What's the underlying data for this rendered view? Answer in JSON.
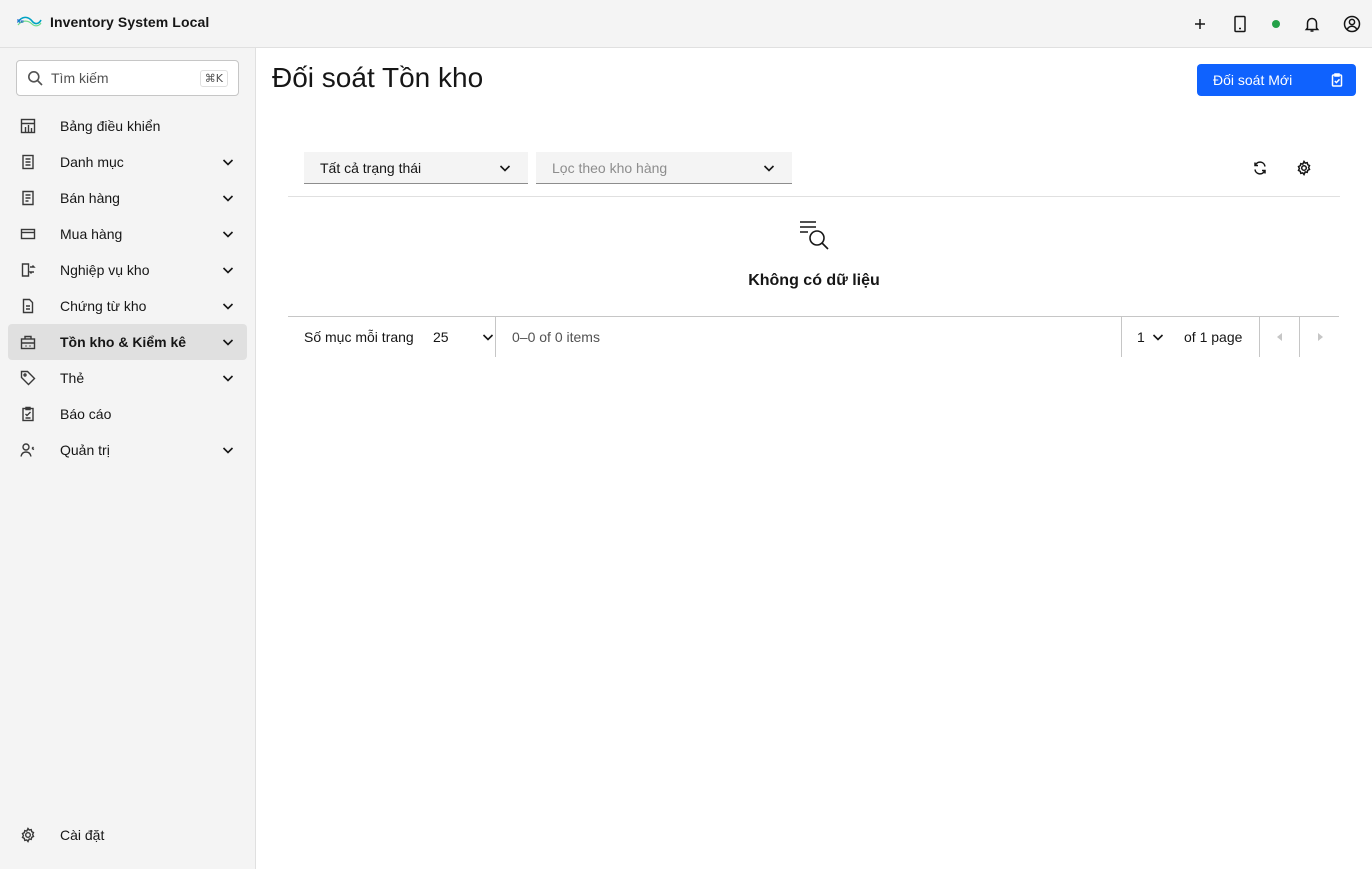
{
  "header": {
    "app_name": "Inventory System Local",
    "icons": [
      "add-icon",
      "tablet-icon",
      "status-dot",
      "notification-icon",
      "user-avatar-icon"
    ],
    "status_color": "#24a148"
  },
  "sidebar": {
    "search": {
      "placeholder": "Tìm kiếm",
      "shortcut": "⌘K"
    },
    "items": [
      {
        "label": "Bảng điều khiển",
        "icon": "dashboard-icon",
        "expandable": false
      },
      {
        "label": "Danh mục",
        "icon": "catalog-icon",
        "expandable": true
      },
      {
        "label": "Bán hàng",
        "icon": "receipt-icon",
        "expandable": true
      },
      {
        "label": "Mua hàng",
        "icon": "credit-card-icon",
        "expandable": true
      },
      {
        "label": "Nghiệp vụ kho",
        "icon": "transfer-icon",
        "expandable": true
      },
      {
        "label": "Chứng từ kho",
        "icon": "document-icon",
        "expandable": true
      },
      {
        "label": "Tồn kho & Kiểm kê",
        "icon": "inventory-icon",
        "expandable": true,
        "active": true
      },
      {
        "label": "Thẻ",
        "icon": "tag-icon",
        "expandable": true
      },
      {
        "label": "Báo cáo",
        "icon": "report-icon",
        "expandable": false
      },
      {
        "label": "Quản trị",
        "icon": "user-admin-icon",
        "expandable": true
      }
    ],
    "settings_label": "Cài đặt"
  },
  "main": {
    "title": "Đối soát Tồn kho",
    "primary_button": "Đối soát Mới",
    "accent_color": "#0f62fe",
    "filters": {
      "status": "Tất cả trạng thái",
      "warehouse_placeholder": "Lọc theo kho hàng"
    },
    "empty_text": "Không có dữ liệu",
    "pagination": {
      "per_page_label": "Số mục mỗi trang",
      "per_page_value": "25",
      "range_text": "0–0 of 0 items",
      "page_value": "1",
      "of_text": "of 1 page"
    }
  }
}
